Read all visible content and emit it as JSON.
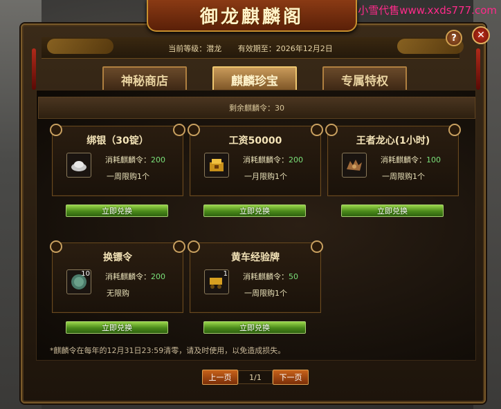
{
  "watermark": "小雪代售www.xxds777.com",
  "window": {
    "title": "御龙麒麟阁",
    "help_label": "?",
    "close_label": "✕"
  },
  "header": {
    "level": "当前等级：潜龙",
    "expiry": "有效期至：2026年12月2日"
  },
  "tabs": [
    {
      "label": "神秘商店",
      "active": false
    },
    {
      "label": "麒麟珍宝",
      "active": true
    },
    {
      "label": "专属特权",
      "active": false
    }
  ],
  "remaining": "剩余麒麟令：30",
  "cost_label": "消耗麒麟令：",
  "exchange_label": "立即兑换",
  "items": [
    {
      "name": "绑银（30锭）",
      "cost": "200",
      "limit": "一周限购1个",
      "icon": "silver-ingot-icon",
      "qty": ""
    },
    {
      "name": "工资50000",
      "cost": "200",
      "limit": "一月限购1个",
      "icon": "salary-box-icon",
      "qty": ""
    },
    {
      "name": "王者龙心(1小时)",
      "cost": "100",
      "limit": "一周限购1个",
      "icon": "dragon-heart-icon",
      "qty": ""
    },
    {
      "name": "换镖令",
      "cost": "200",
      "limit": "无限购",
      "icon": "escort-token-icon",
      "qty": "10"
    },
    {
      "name": "黄车经验牌",
      "cost": "50",
      "limit": "一周限购1个",
      "icon": "gold-cart-icon",
      "qty": "1"
    }
  ],
  "note": "*麒麟令在每年的12月31日23:59清零，请及时使用，以免造成损失。",
  "pager": {
    "prev": "上一页",
    "page": "1/1",
    "next": "下一页"
  }
}
